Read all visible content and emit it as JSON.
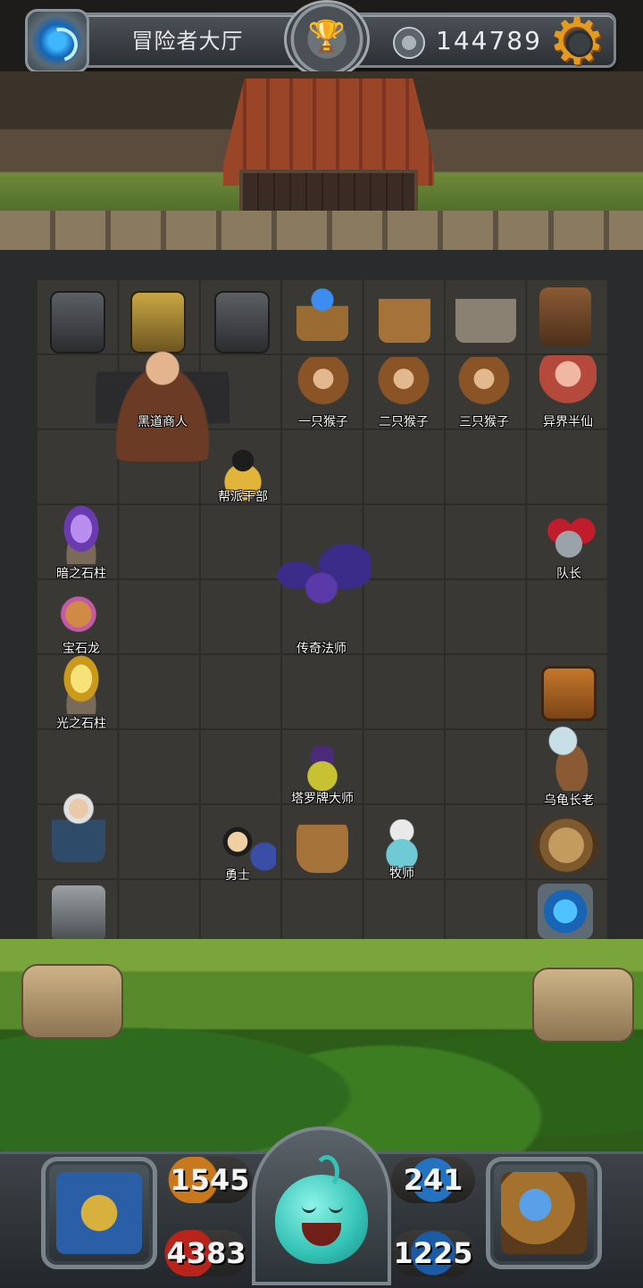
{
  "top_bar": {
    "portal_icon": "blue-portal-icon",
    "hall_title": "冒险者大厅",
    "trophy_icon": "trophy-icon",
    "coin_icon": "spartan-helmet-coin-icon",
    "coin_value": "144789",
    "settings_icon": "gear-icon"
  },
  "npcs": {
    "black_market_merchant": "黑道商人",
    "gang_officer": "帮派干部",
    "monkey_one": "一只猴子",
    "monkey_two": "二只猴子",
    "monkey_three": "三只猴子",
    "otherworld_sage": "异界半仙",
    "dark_stone_pillar": "暗之石柱",
    "captain": "队长",
    "gem_dragon": "宝石龙",
    "legendary_mage": "传奇法师",
    "light_stone_pillar": "光之石柱",
    "turtle_elder": "乌龟长老",
    "tarot_master": "塔罗牌大师",
    "warrior": "勇士",
    "priest": "牧师"
  },
  "props": {
    "safe_left": "safe-icon",
    "golden_altar": "golden-altar-icon",
    "safe_plant": "safe-with-plant-icon",
    "crystal_ball_table": "crystal-ball-table-icon",
    "potion_table": "potion-table-icon",
    "skeleton_table": "skeleton-table-icon",
    "weapon_rack": "weapon-rack-icon",
    "old_tv": "old-tv-icon",
    "round_tile": "round-seal-tile-icon",
    "card_table": "card-table-icon",
    "cyber_npc": "cyber-ninja-icon",
    "trash_can": "trash-can-icon",
    "exit_portal": "exit-portal-icon"
  },
  "hud": {
    "attack": "1545",
    "hp": "4383",
    "mp": "241",
    "defense": "1225",
    "equipment_icon": "armor-equipment-icon",
    "player_icon": "slime-avatar-icon",
    "spellbook_icon": "spellbook-icon"
  }
}
